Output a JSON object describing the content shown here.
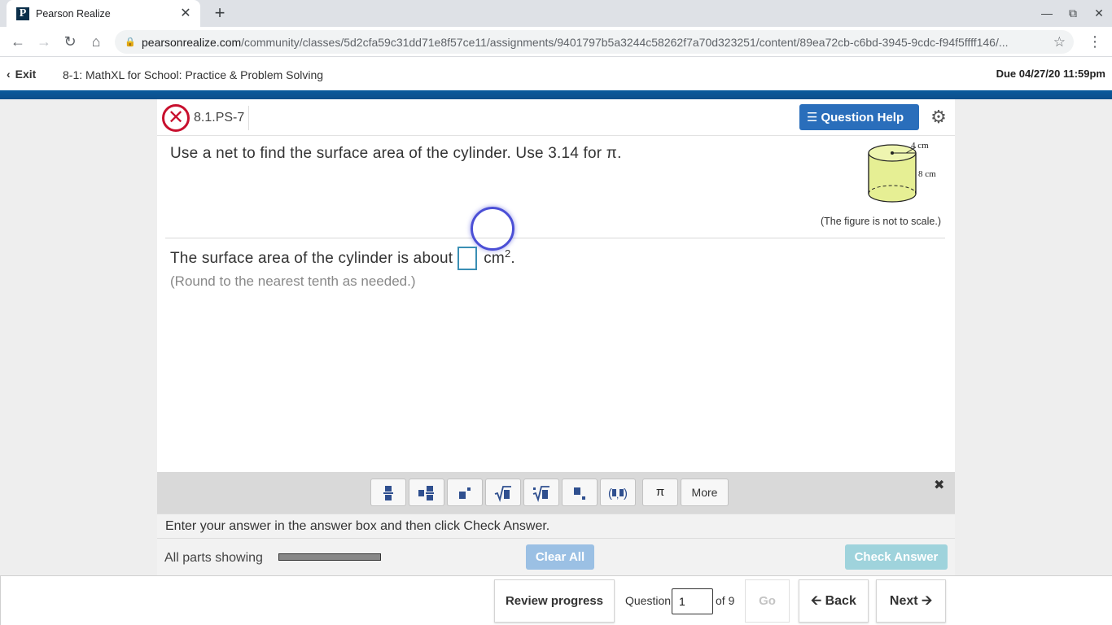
{
  "browser": {
    "tab_title": "Pearson Realize",
    "favicon_letter": "P",
    "tab_close": "✕",
    "new_tab": "+",
    "url_host": "pearsonrealize.com",
    "url_path": "/community/classes/5d2cfa59c31dd71e8f57ce11/assignments/9401797b5a3244c58262f7a70d323251/content/89ea72cb-c6bd-3945-9cdc-f94f5ffff146/..."
  },
  "header": {
    "exit_label": "Exit",
    "assignment_title": "8-1: MathXL for School: Practice & Problem Solving",
    "due": "Due 04/27/20 11:59pm"
  },
  "question": {
    "id": "8.1.PS-7",
    "help_label": "Question Help",
    "prompt": "Use a net to find the surface area of the cylinder. Use 3.14 for π.",
    "figure": {
      "radius_label": "4 cm",
      "height_label": "8 cm",
      "caption": "(The figure is not to scale.)"
    },
    "answer_prefix": "The surface area of the cylinder is about",
    "answer_unit": "cm",
    "answer_unit_exp": "2",
    "answer_suffix": ".",
    "round_note": "(Round to the nearest tenth as needed.)"
  },
  "palette": {
    "buttons": [
      {
        "name": "fraction",
        "glyph": "▪̲▪"
      },
      {
        "name": "mixed-number",
        "glyph": "▪▪"
      },
      {
        "name": "exponent",
        "glyph": "▪˙"
      },
      {
        "name": "square-root",
        "glyph": "√▪"
      },
      {
        "name": "nth-root",
        "glyph": "∜▪"
      },
      {
        "name": "subscript",
        "glyph": "▪."
      },
      {
        "name": "ordered-pair",
        "glyph": "(▪,▪)"
      },
      {
        "name": "pi",
        "glyph": "π"
      }
    ],
    "more_label": "More",
    "close_glyph": "✖"
  },
  "instructions": "Enter your answer in the answer box and then click Check Answer.",
  "status": {
    "parts_label": "All parts showing",
    "parts_progress": 1.0,
    "clear_label": "Clear All",
    "check_label": "Check Answer"
  },
  "footer": {
    "review_label": "Review progress",
    "question_label": "Question",
    "question_value": "1",
    "of_label": "of 9",
    "go_label": "Go",
    "back_label": "Back",
    "next_label": "Next"
  },
  "colors": {
    "brand_blue": "#0d4f8b",
    "help_button": "#2a6ebb",
    "error_red": "#c8102e",
    "cylinder_fill": "#e6ef94"
  }
}
